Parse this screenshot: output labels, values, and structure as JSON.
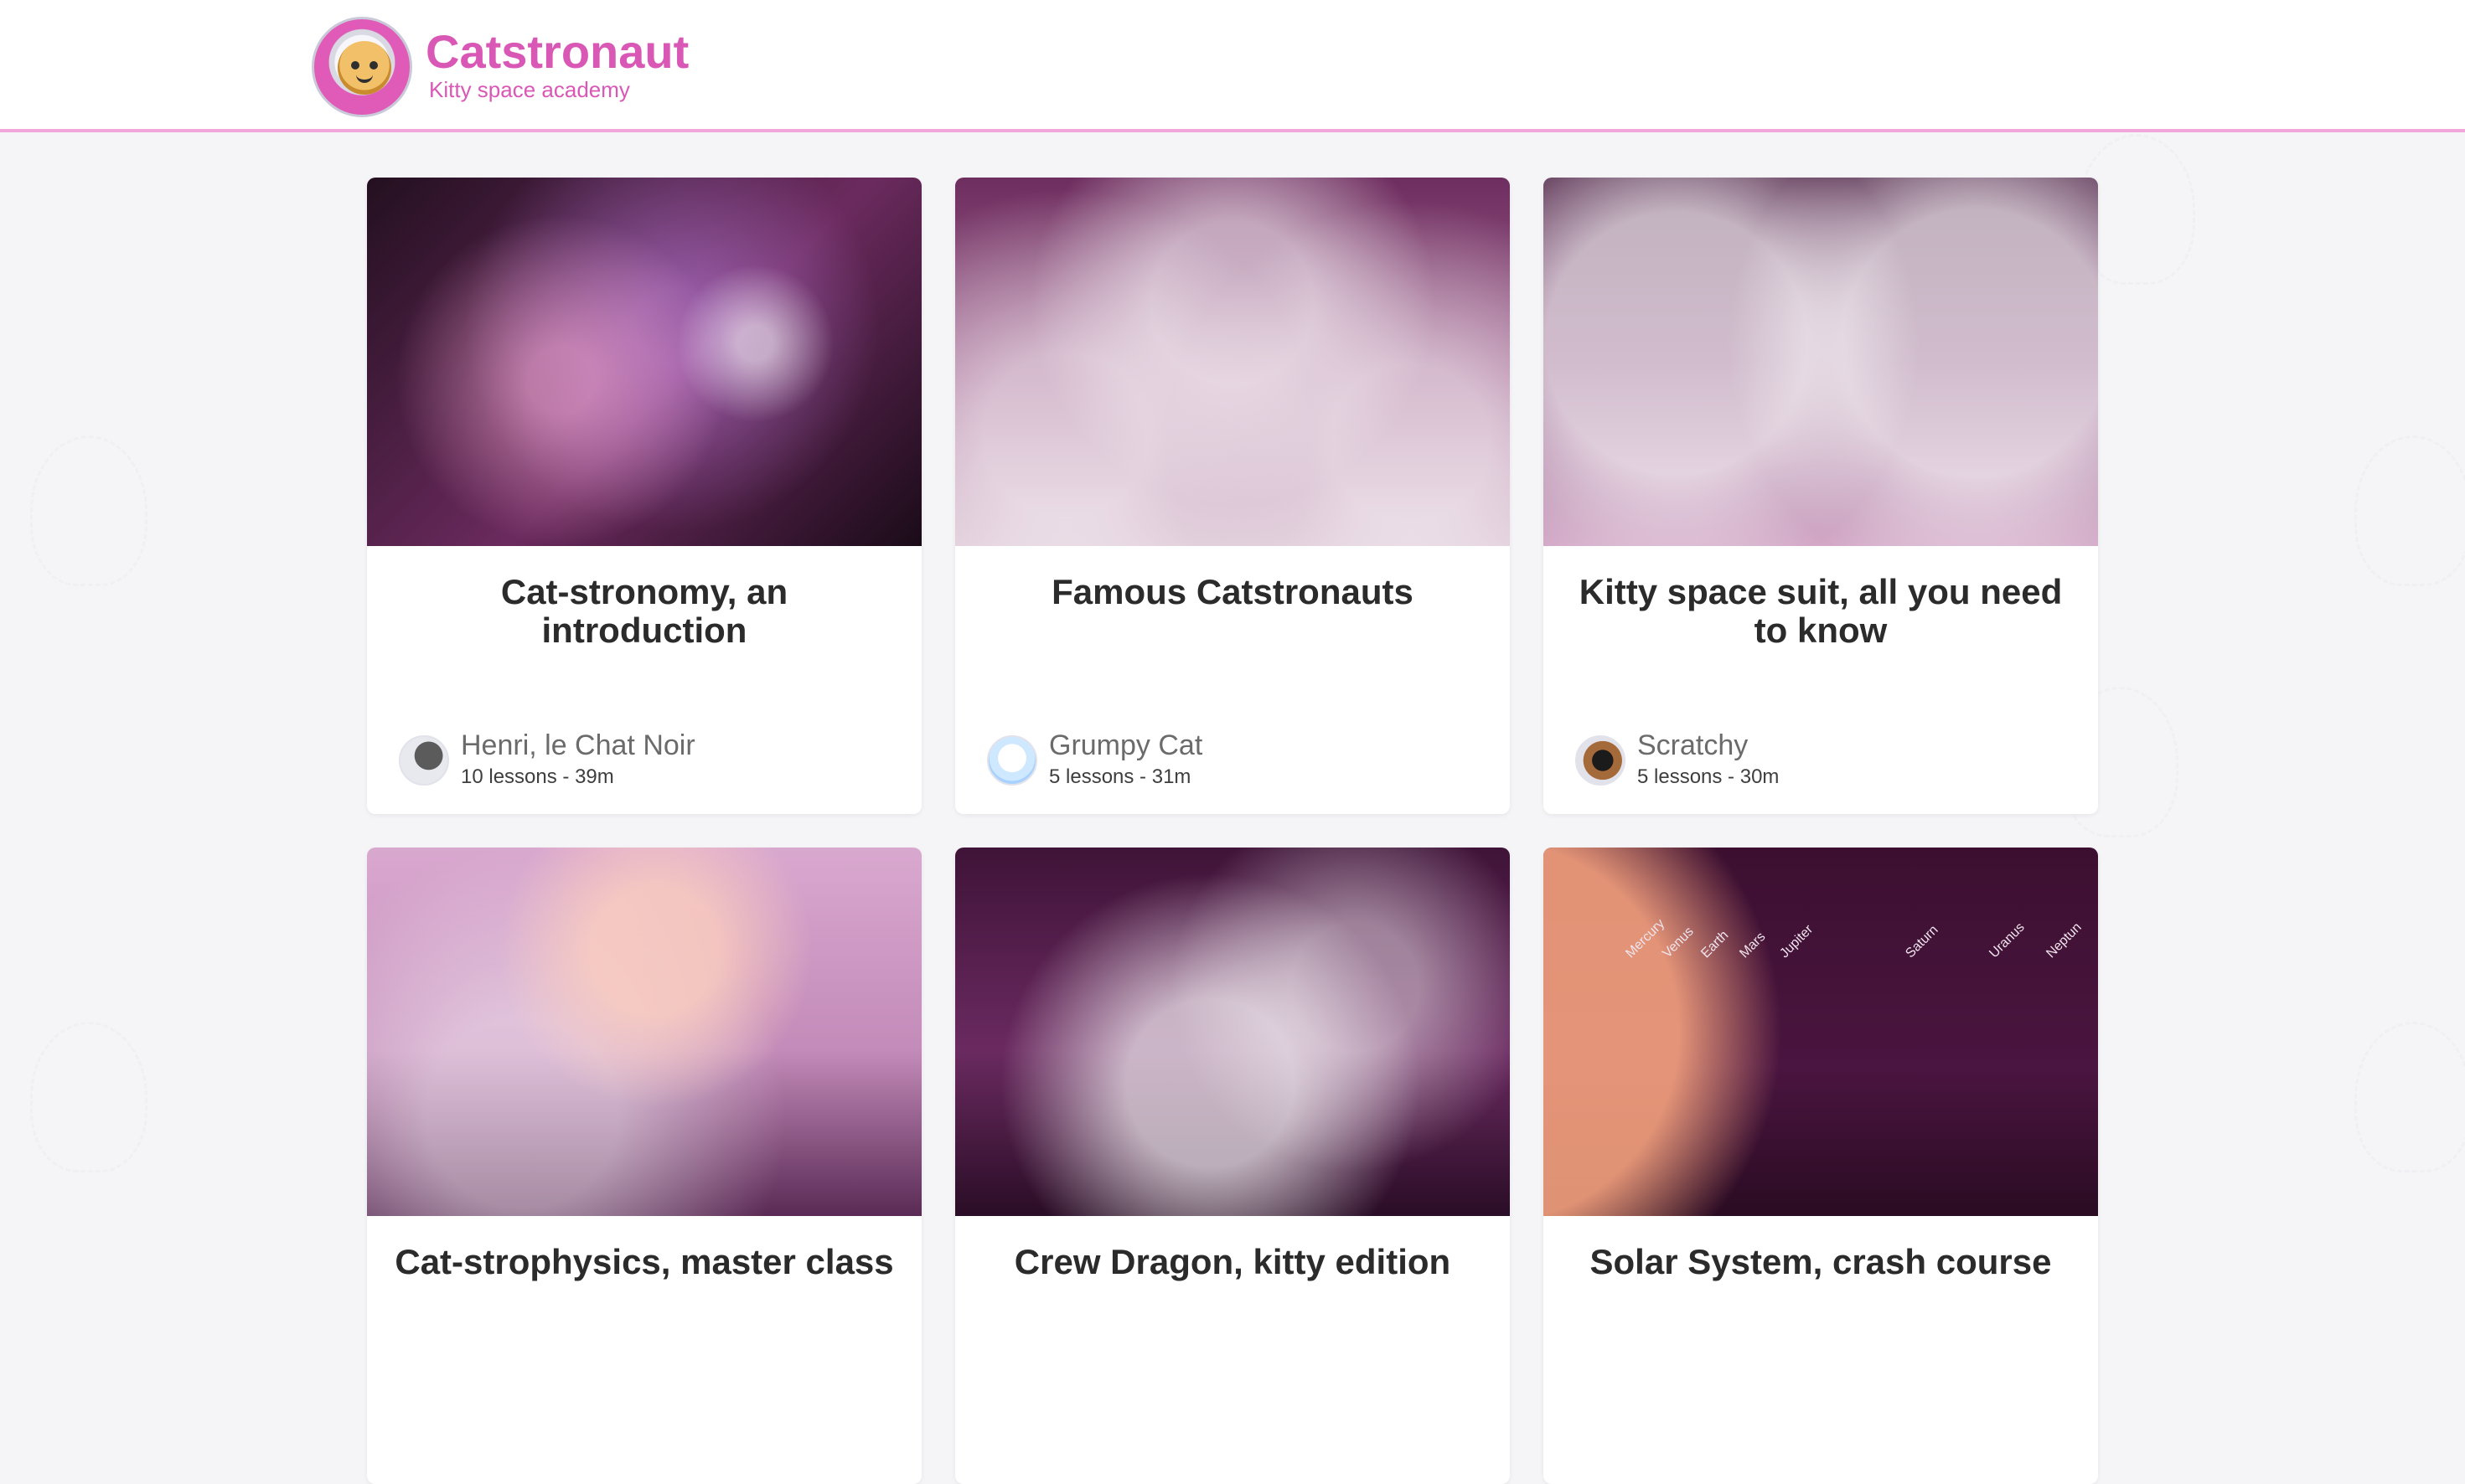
{
  "app": {
    "brand_title": "Catstronaut",
    "brand_subtitle": "Kitty space academy"
  },
  "colors": {
    "brand": "#d958b6",
    "header_border": "#f3a6d9",
    "page_bg": "#f5f5f7",
    "card_bg": "#ffffff"
  },
  "courses": [
    {
      "title": "Cat-stronomy, an introduction",
      "author": "Henri, le Chat Noir",
      "meta": "10 lessons - 39m",
      "image": "nebula-cat"
    },
    {
      "title": "Famous Catstronauts",
      "author": "Grumpy Cat",
      "meta": "5 lessons - 31m",
      "image": "catstronaut-crew"
    },
    {
      "title": "Kitty space suit, all you need to know",
      "author": "Scratchy",
      "meta": "5 lessons - 30m",
      "image": "helmets-cats"
    },
    {
      "title": "Cat-strophysics, master class",
      "image": "suit-cat"
    },
    {
      "title": "Crew Dragon, kitty edition",
      "image": "crew-dragon-cat"
    },
    {
      "title": "Solar System, crash course",
      "image": "solar-system-cats",
      "planet_labels": [
        "Mercury",
        "Venus",
        "Earth",
        "Mars",
        "Jupiter",
        "Saturn",
        "Uranus",
        "Neptun"
      ]
    }
  ]
}
